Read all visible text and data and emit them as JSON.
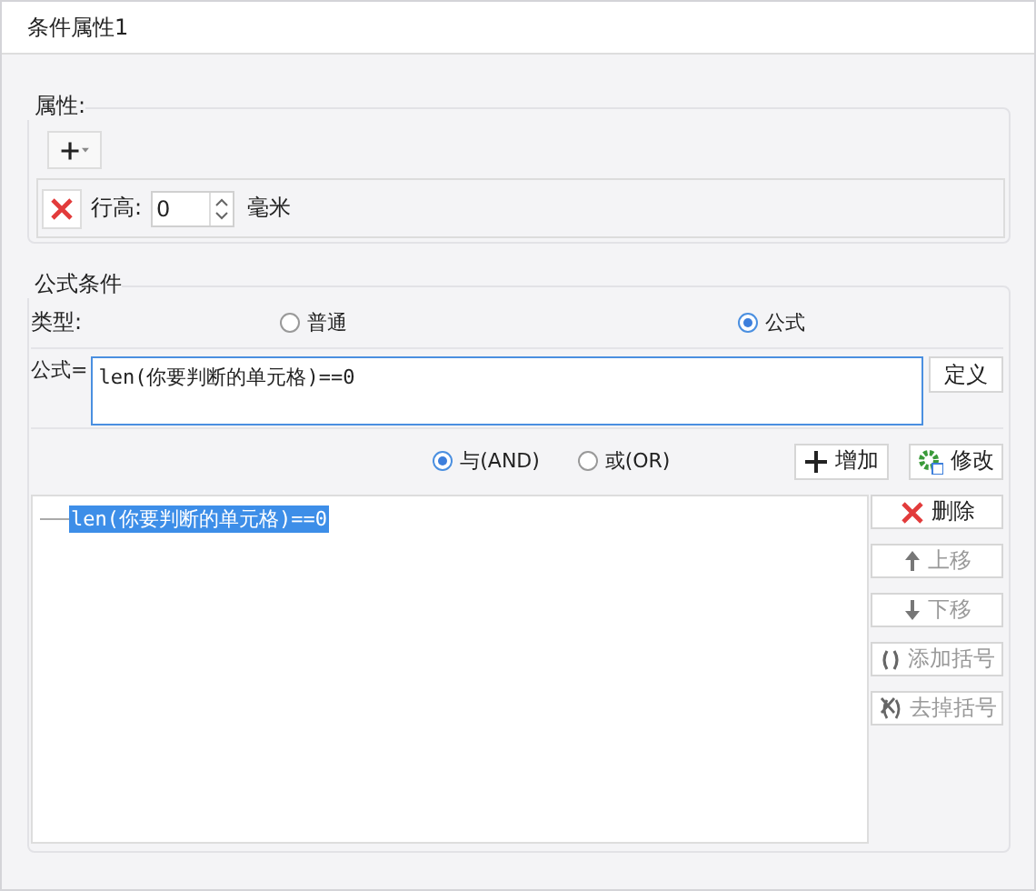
{
  "window": {
    "title": "条件属性1"
  },
  "attributes": {
    "title": "属性:",
    "row_height": {
      "label": "行高:",
      "value": "0",
      "unit": "毫米"
    }
  },
  "formula_condition": {
    "title": "公式条件",
    "type_label": "类型:",
    "type_options": [
      {
        "label": "普通",
        "selected": false
      },
      {
        "label": "公式",
        "selected": true
      }
    ],
    "formula_label": "公式=",
    "formula_value": "len(你要判断的单元格)==0",
    "define_button": "定义",
    "logic_options": [
      {
        "label": "与(AND)",
        "selected": true
      },
      {
        "label": "或(OR)",
        "selected": false
      }
    ],
    "add_button": "增加",
    "modify_button": "修改",
    "conditions": [
      {
        "text": "len(你要判断的单元格)==0",
        "selected": true
      }
    ],
    "actions": [
      {
        "label": "删除",
        "kind": "delete",
        "disabled": false
      },
      {
        "label": "上移",
        "kind": "up",
        "disabled": true
      },
      {
        "label": "下移",
        "kind": "down",
        "disabled": true
      },
      {
        "label": "添加括号",
        "kind": "add-parens",
        "disabled": true
      },
      {
        "label": "去掉括号",
        "kind": "remove-parens",
        "disabled": true
      }
    ]
  }
}
